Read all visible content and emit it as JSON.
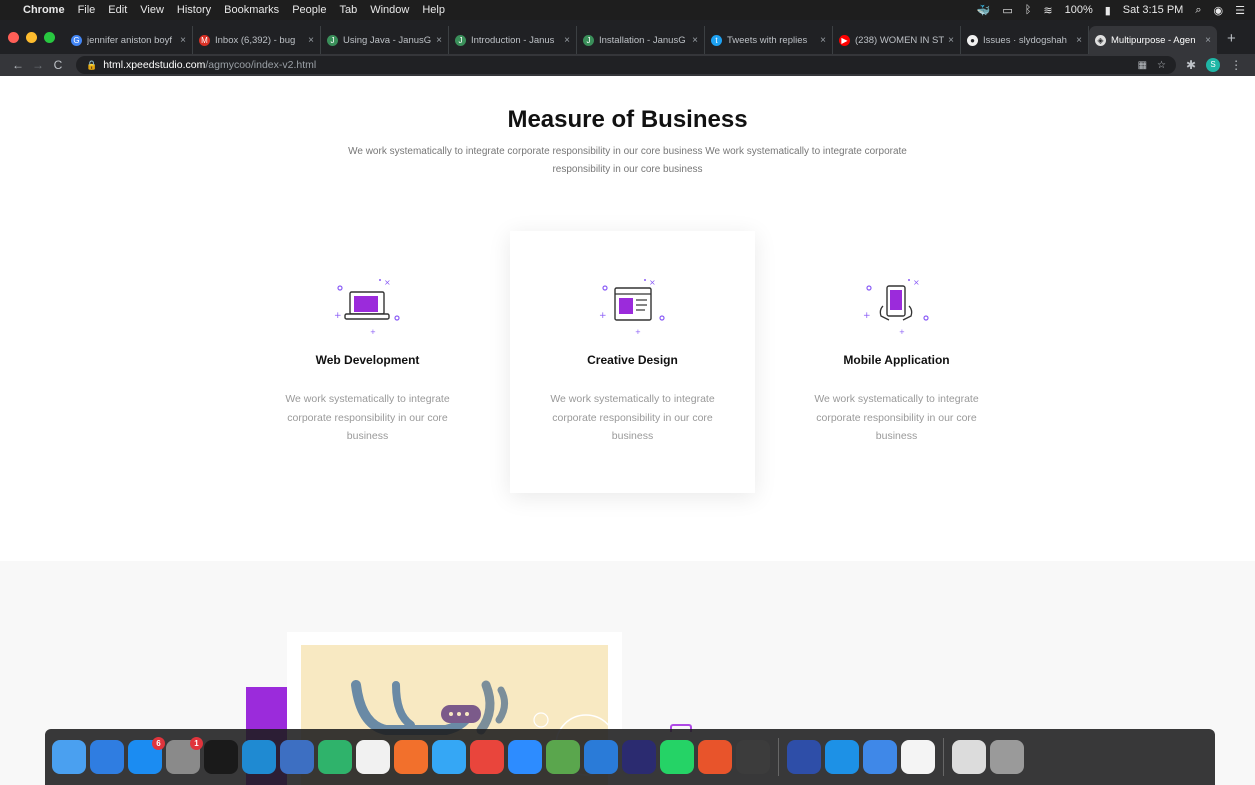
{
  "menubar": {
    "app": "Chrome",
    "items": [
      "File",
      "Edit",
      "View",
      "History",
      "Bookmarks",
      "People",
      "Tab",
      "Window",
      "Help"
    ],
    "battery": "100%",
    "clock": "Sat 3:15 PM"
  },
  "tabs": [
    {
      "title": "jennifer aniston boyf",
      "favicon_color": "#4285f4",
      "favicon": "G"
    },
    {
      "title": "Inbox (6,392) - bug",
      "favicon_color": "#d93025",
      "favicon": "M"
    },
    {
      "title": "Using Java - JanusG",
      "favicon_color": "#3a8f5a",
      "favicon": "J"
    },
    {
      "title": "Introduction - Janus",
      "favicon_color": "#3a8f5a",
      "favicon": "J"
    },
    {
      "title": "Installation - JanusG",
      "favicon_color": "#3a8f5a",
      "favicon": "J"
    },
    {
      "title": "Tweets with replies",
      "favicon_color": "#1da1f2",
      "favicon": "t"
    },
    {
      "title": "(238) WOMEN IN ST",
      "favicon_color": "#ff0000",
      "favicon": "▶"
    },
    {
      "title": "Issues · slydogshah",
      "favicon_color": "#f0f0f0",
      "favicon": "●"
    },
    {
      "title": "Multipurpose - Agen",
      "favicon_color": "#e0e0e0",
      "favicon": "◈",
      "active": true
    }
  ],
  "toolbar": {
    "url_host": "html.xpeedstudio.com",
    "url_path": "/agmycoo/index-v2.html",
    "profile_initial": "S"
  },
  "page": {
    "title": "Measure of Business",
    "subtitle": "We work systematically to integrate corporate responsibility in our core business We work systematically to integrate corporate responsibility in our core business",
    "services": [
      {
        "title": "Web Development",
        "description": "We work systematically to integrate corporate responsibility in our core business",
        "icon": "laptop-icon"
      },
      {
        "title": "Creative Design",
        "description": "We work systematically to integrate corporate responsibility in our core business",
        "icon": "design-icon"
      },
      {
        "title": "Mobile Application",
        "description": "We work systematically to integrate corporate responsibility in our core business",
        "icon": "mobile-icon"
      }
    ]
  },
  "dock": {
    "items": [
      {
        "name": "finder",
        "color": "#4aa0f0"
      },
      {
        "name": "safari",
        "color": "#2f7de1"
      },
      {
        "name": "app-store",
        "color": "#1b8cf2",
        "badge": "6"
      },
      {
        "name": "system-preferences",
        "color": "#8a8a8a",
        "badge": "1"
      },
      {
        "name": "terminal",
        "color": "#1a1a1a"
      },
      {
        "name": "vscode",
        "color": "#1f8ad2"
      },
      {
        "name": "xcode",
        "color": "#3d6fc2"
      },
      {
        "name": "gitkraken",
        "color": "#2fb36b"
      },
      {
        "name": "textedit",
        "color": "#f1f1f1"
      },
      {
        "name": "swift",
        "color": "#f2702c"
      },
      {
        "name": "messages",
        "color": "#35a7f5"
      },
      {
        "name": "chrome",
        "color": "#e9453c"
      },
      {
        "name": "zoom",
        "color": "#2d8cff"
      },
      {
        "name": "sketchup",
        "color": "#5aa64d"
      },
      {
        "name": "keynote-charts",
        "color": "#2a7bd8"
      },
      {
        "name": "intellij",
        "color": "#2b2b70"
      },
      {
        "name": "whatsapp",
        "color": "#25d366"
      },
      {
        "name": "neo4j",
        "color": "#e8542b"
      },
      {
        "name": "activity-monitor",
        "color": "#3c3c3c"
      },
      {
        "name": "quicktime",
        "color": "#2e4ea8"
      },
      {
        "name": "docker",
        "color": "#1d91e6"
      },
      {
        "name": "xcode-dev",
        "color": "#3f88e8"
      },
      {
        "name": "sourcetree",
        "color": "#f4f4f4"
      },
      {
        "name": "archive",
        "color": "#dcdcdc"
      },
      {
        "name": "trash",
        "color": "#9a9a9a"
      }
    ]
  }
}
